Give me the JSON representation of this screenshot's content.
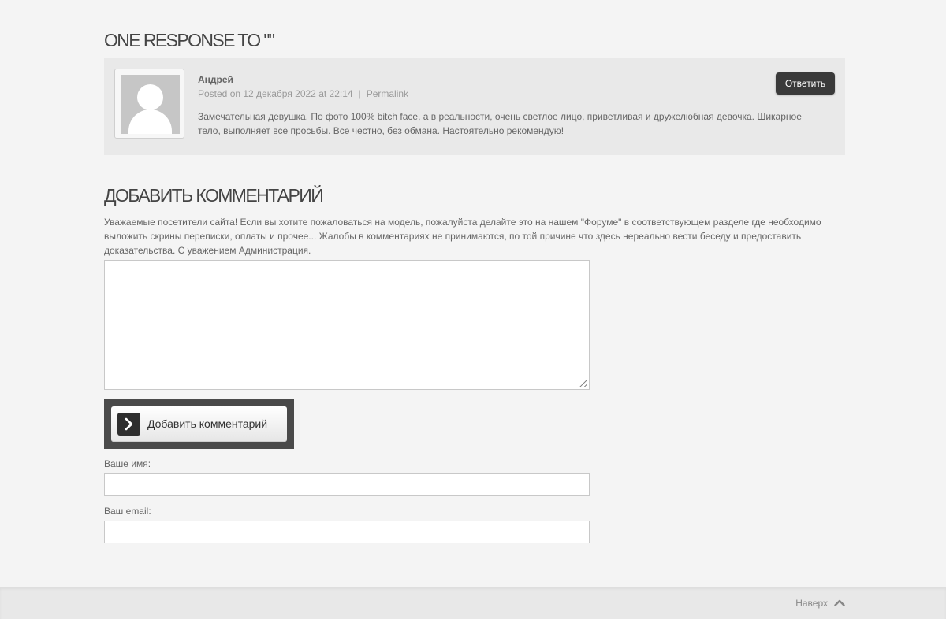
{
  "responses_title": "One Response to \"\"",
  "comment": {
    "author": "Андрей",
    "posted": "Posted on 12 декабря 2022 at 22:14",
    "separator": "|",
    "permalink": "Permalink",
    "text": "Замечательная девушка. По фото 100% bitch face, а в реальности, очень светлое лицо, приветливая и дружелюбная девочка. Шикарное тело, выполняет все просьбы. Все честно, без обмана. Настоятельно рекомендую!",
    "reply_label": "Ответить",
    "avatar_icon": "default-user-avatar-icon"
  },
  "add_comment": {
    "title": "Добавить комментарий",
    "notice": "Уважаемые посетители сайта! Если вы хотите пожаловаться на модель, пожалуйста делайте это на нашем \"Форуме\" в соответствующем разделе где необходимо выложить скрины переписки, оплаты и прочее... Жалобы в комментариях не принимаются, по той причине что здесь нереально вести беседу и предоставить доказательства. С уважением Администрация.",
    "textarea_value": "",
    "submit_label": "Добавить комментарий",
    "submit_icon": "chevron-right-icon",
    "name_label": "Ваше имя:",
    "name_value": "",
    "email_label": "Ваш email:",
    "email_value": ""
  },
  "footer": {
    "to_top_label": "Наверх",
    "to_top_icon": "chevron-up-icon"
  },
  "colors": {
    "page_bg": "#f4f4f4",
    "comment_bg": "#e9e9e9",
    "reply_button": "#3a3a3a",
    "submit_frame": "#4a4a4a"
  }
}
